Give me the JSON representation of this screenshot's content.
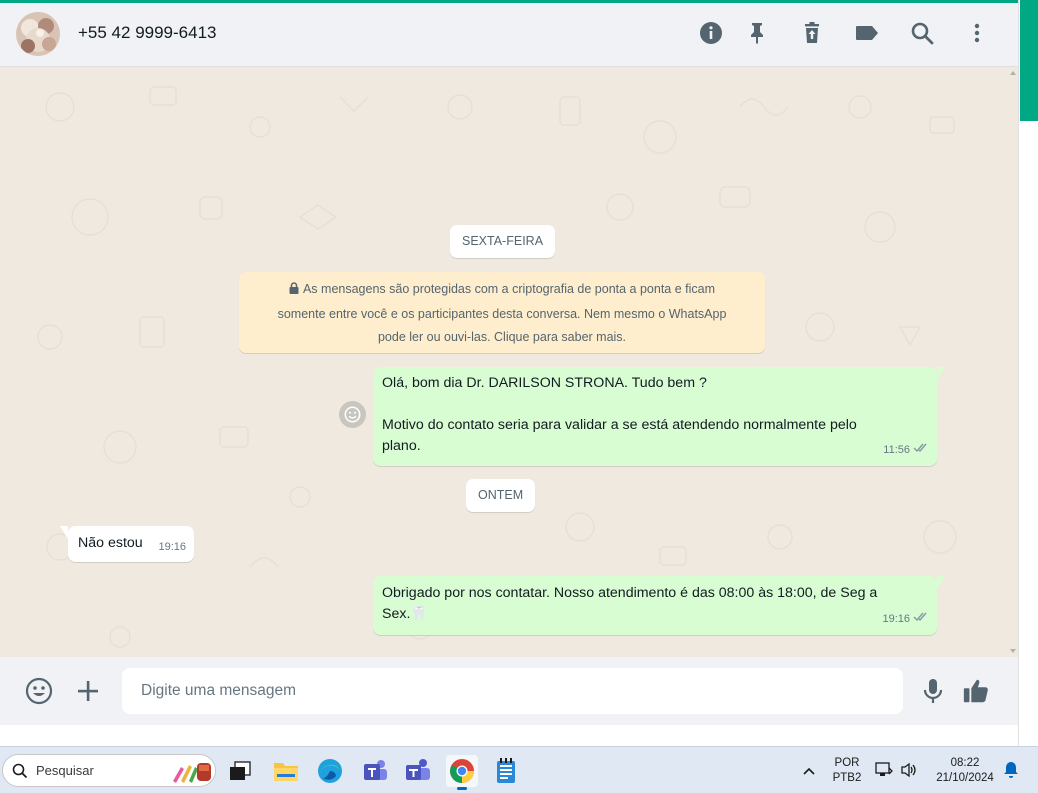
{
  "header": {
    "contact_name": "+55 42 9999-6413",
    "icons": [
      "info-icon",
      "pin-icon",
      "trash-icon",
      "label-icon",
      "search-icon",
      "menu-icon"
    ]
  },
  "chat": {
    "date_chips": [
      "SEXTA-FEIRA",
      "ONTEM"
    ],
    "encryption_notice": {
      "line1": "As mensagens são protegidas com a criptografia de ponta a ponta e ficam",
      "line2": "somente entre você e os participantes desta conversa. Nem mesmo o WhatsApp",
      "line3": "pode ler ou ouvi-las. Clique para saber mais."
    },
    "messages": [
      {
        "direction": "out",
        "line1": "Olá, bom dia Dr. DARILSON STRONA. Tudo bem ?",
        "line2": "Motivo do contato seria para validar a se está atendendo normalmente pelo",
        "line3": "plano.",
        "time": "11:56",
        "status": "read"
      },
      {
        "direction": "in",
        "text": "Não estou",
        "time": "19:16"
      },
      {
        "direction": "out",
        "line1": "Obrigado por nos contatar. Nosso atendimento é das 08:00 às 18:00, de Seg a",
        "line2": "Sex.🦷",
        "time": "19:16",
        "status": "read"
      }
    ]
  },
  "composer": {
    "placeholder": "Digite uma mensagem"
  },
  "taskbar": {
    "search_label": "Pesquisar",
    "language_line1": "POR",
    "language_line2": "PTB2",
    "clock_time": "08:22",
    "clock_date": "21/10/2024"
  },
  "colors": {
    "accent": "#00a884",
    "outgoing_bubble": "#d9fdd3",
    "incoming_bubble": "#ffffff",
    "encryption_notice": "#ffeecd",
    "chat_background": "#efe9df"
  }
}
